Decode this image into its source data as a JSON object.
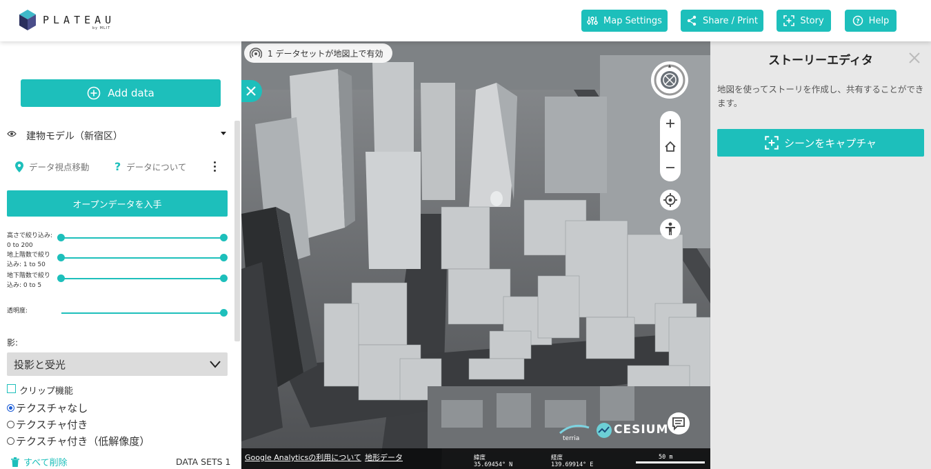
{
  "header": {
    "logo_text": "PLATEAU",
    "logo_sub": "by MLIT",
    "buttons": {
      "map_settings": "Map Settings",
      "share_print": "Share / Print",
      "story": "Story",
      "help": "Help"
    }
  },
  "left": {
    "add_data": "Add data",
    "dataset_title": "建物モデル（新宿区）",
    "action_fly": "データ視点移動",
    "action_about": "データについて",
    "open_data_button": "オープンデータを入手",
    "sliders": [
      {
        "label_1": "高さで絞り込み:",
        "label_2": "0 to 200"
      },
      {
        "label_1": "地上階数で絞り",
        "label_2": "込み: 1 to 50"
      },
      {
        "label_1": "地下階数で絞り",
        "label_2": "込み: 0 to 5"
      }
    ],
    "opacity_label": "透明度:",
    "shadow_label": "影:",
    "shadow_select": "投影と受光",
    "clip_label": "クリップ機能",
    "radios": [
      "テクスチャなし",
      "テクスチャ付き",
      "テクスチャ付き（低解像度）"
    ],
    "delete_all": "すべて削除",
    "datasets_count": "DATA SETS 1"
  },
  "map": {
    "pill_text": "1 データセットが地図上で有効",
    "analytics_link": "Google Analyticsの利用について",
    "terrain_link": "地形データ",
    "lat_label": "緯度",
    "lat_value": "35.69454° N",
    "lon_label": "経度",
    "lon_value": "139.69914° E",
    "scale_text": "50 m",
    "cesium_text": "CESIUM",
    "accent": "#1dbfbb"
  },
  "right": {
    "title": "ストーリーエディタ",
    "description": "地図を使ってストーリを作成し、共有することができます。",
    "capture_button": "シーンをキャプチャ"
  }
}
